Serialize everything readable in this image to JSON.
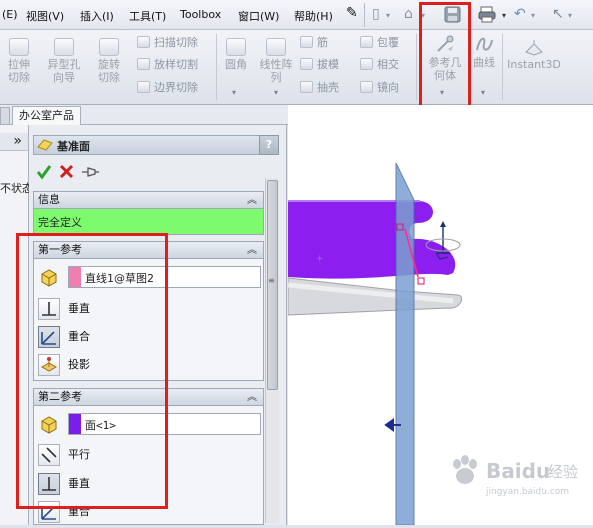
{
  "menu": {
    "edit_partial": "(E)",
    "view": "视图(V)",
    "insert": "插入(I)",
    "tools": "工具(T)",
    "toolbox": "Toolbox",
    "window": "窗口(W)",
    "help": "帮助(H)"
  },
  "ribbon": {
    "extrude_cut": "拉伸切除",
    "hole_wizard": "异型孔向导",
    "revolve_cut": "旋转切除",
    "swept_cut": "扫描切除",
    "lofted_cut": "放样切割",
    "boundary_cut": "边界切除",
    "fillet": "圆角",
    "linear_pattern": "线性阵列",
    "rib": "筋",
    "draft": "拔模",
    "shell": "抽壳",
    "wrap": "包覆",
    "intersect": "相交",
    "mirror": "镜向",
    "reference_geometry": "参考几何体",
    "curves": "曲线",
    "instant3d": "Instant3D"
  },
  "tabs": {
    "office_products": "办公室产品"
  },
  "left_strip": {
    "chevron": "»",
    "state_partial": "不状态"
  },
  "property_manager": {
    "title": "基准面",
    "help": "?",
    "message": {
      "header": "信息",
      "status": "完全定义",
      "status_color": "#7dfa6e"
    },
    "first_reference": {
      "header": "第一参考",
      "selection": "直线1@草图2",
      "selection_color": "#f07eb0",
      "options": [
        "垂直",
        "重合",
        "投影"
      ]
    },
    "second_reference": {
      "header": "第二参考",
      "selection": "面<1>",
      "selection_color": "#7a1ee8",
      "options": [
        "平行",
        "垂直",
        "重合"
      ]
    }
  },
  "watermark": {
    "brand": "Baidu",
    "text": "经验",
    "sub": "jingyan.baidu.com"
  },
  "colors": {
    "highlight": "#e01e1e",
    "part_top": "#8c1ff0",
    "plane": "#7c9fd0",
    "ok": "#2ea02e",
    "cancel": "#d01f1f"
  }
}
